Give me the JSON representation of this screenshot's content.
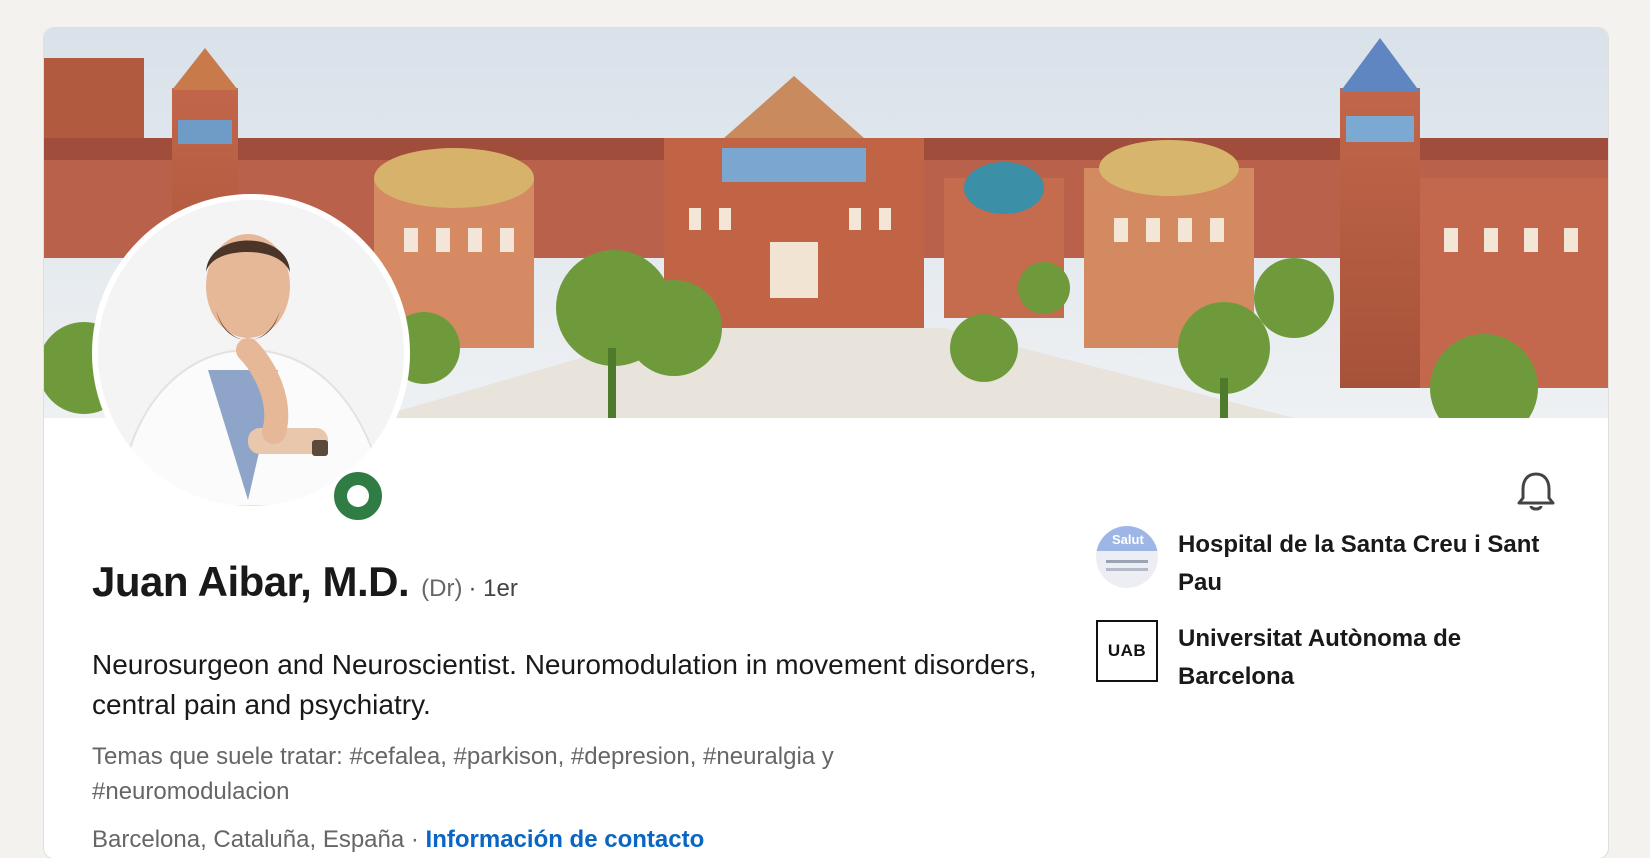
{
  "profile": {
    "name": "Juan Aibar, M.D.",
    "pronoun": "(Dr)",
    "degree": "· 1er",
    "headline": "Neurosurgeon and Neuroscientist. Neuromodulation in movement disorders, central pain and psychiatry.",
    "topics": "Temas que suele tratar: #cefalea, #parkison, #depresion, #neuralgia y #neuromodulacion",
    "location": "Barcelona, Cataluña, España",
    "separator": " · ",
    "contact_link": "Información de contacto",
    "open_to_work_color": "#2f7d45",
    "link_color": "#0a66c2"
  },
  "organizations": [
    {
      "name": "Hospital de la Santa Creu i Sant Pau",
      "logo_text": "Salut"
    },
    {
      "name": "Universitat Autònoma de Barcelona",
      "logo_text": "UAB"
    }
  ],
  "icons": {
    "bell": "bell-icon",
    "status": "status-ring-icon"
  }
}
